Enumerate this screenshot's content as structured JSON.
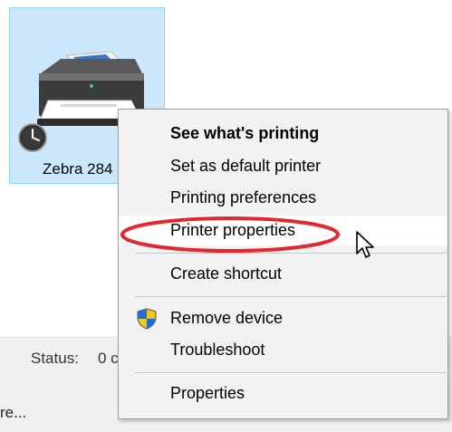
{
  "printer": {
    "name": "Zebra 284"
  },
  "context_menu": {
    "items": [
      {
        "label": "See what's printing",
        "bold": true
      },
      {
        "label": "Set as default printer",
        "bold": false
      },
      {
        "label": "Printing preferences",
        "bold": false
      },
      {
        "label": "Printer properties",
        "bold": false,
        "highlighted": true
      },
      {
        "label": "Create shortcut",
        "bold": false
      },
      {
        "label": "Remove device",
        "bold": false,
        "icon": "uac-shield-icon"
      },
      {
        "label": "Troubleshoot",
        "bold": false
      },
      {
        "label": "Properties",
        "bold": false
      }
    ]
  },
  "details": {
    "status_label": "Status:",
    "status_value": "0 c",
    "bottom_text": "re..."
  },
  "colors": {
    "selection_fill": "#cce8ff",
    "selection_border": "#99d1ff",
    "menu_background": "#f2f2f2",
    "annotation_red": "#e0282e"
  },
  "icons": {
    "printer": "printer-icon",
    "clock": "clock-icon",
    "shield": "uac-shield-icon",
    "cursor": "mouse-cursor-icon"
  }
}
